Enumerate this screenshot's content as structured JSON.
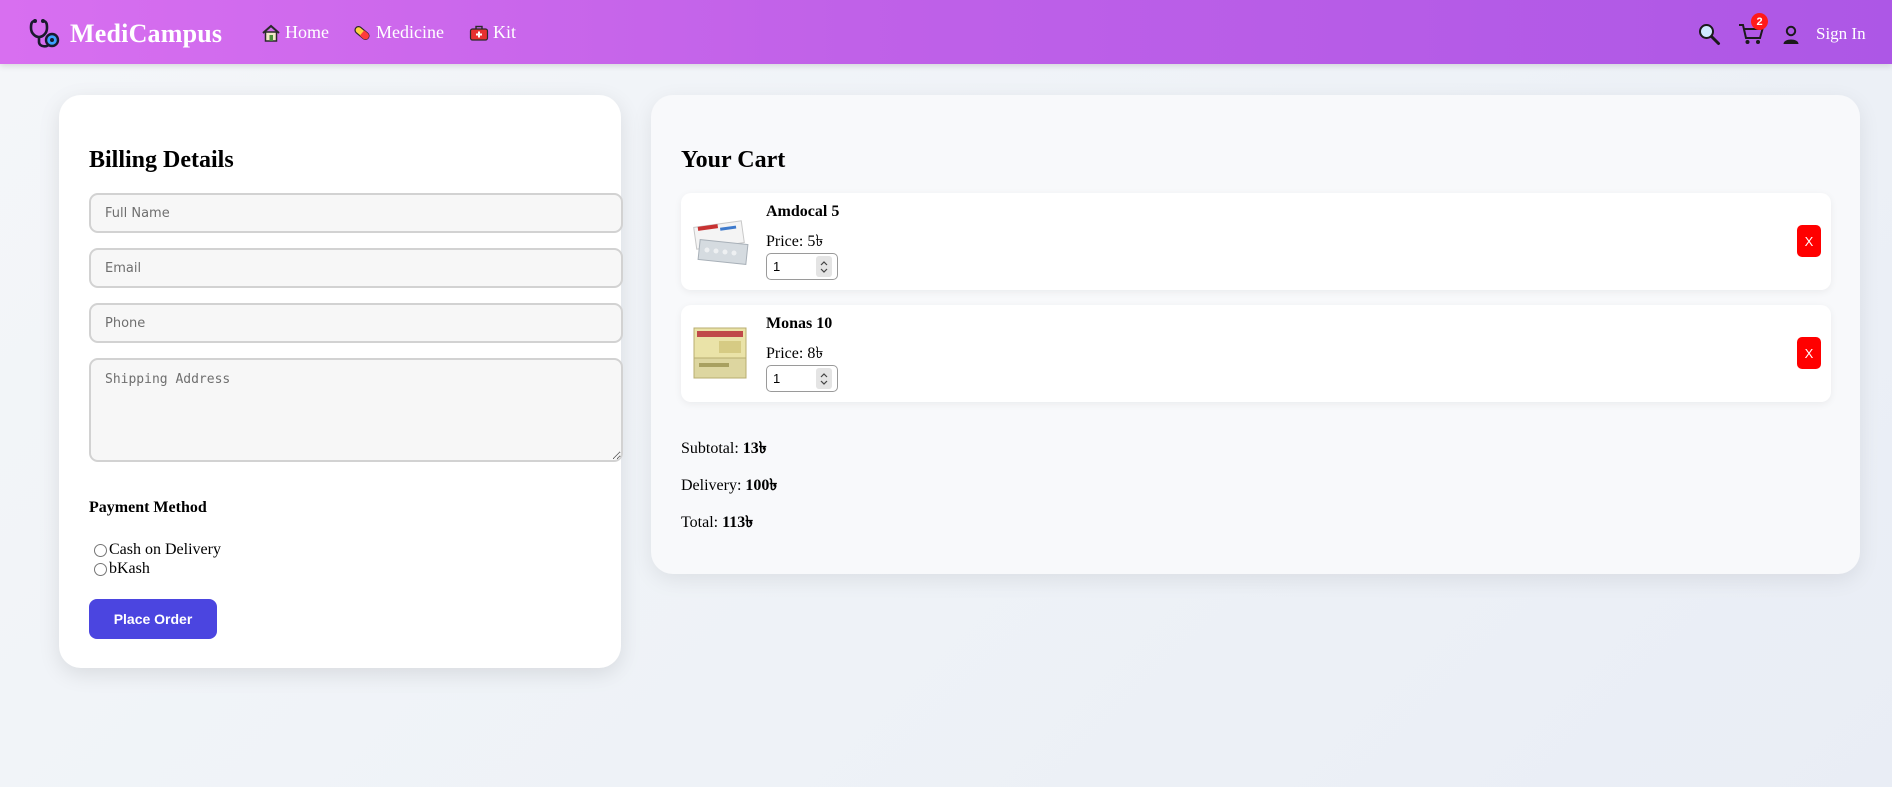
{
  "navbar": {
    "brand": "MediCampus",
    "links": [
      {
        "label": "Home",
        "icon": "home-icon"
      },
      {
        "label": "Medicine",
        "icon": "pill-icon"
      },
      {
        "label": "Kit",
        "icon": "medical-kit-icon"
      }
    ],
    "cart_count": "2",
    "sign_in": "Sign In"
  },
  "billing": {
    "title": "Billing Details",
    "full_name_placeholder": "Full Name",
    "email_placeholder": "Email",
    "phone_placeholder": "Phone",
    "address_placeholder": "Shipping Address",
    "payment_label": "Payment Method",
    "payment_options": [
      "Cash on Delivery",
      "bKash"
    ],
    "place_order": "Place Order"
  },
  "cart": {
    "title": "Your Cart",
    "items": [
      {
        "name": "Amdocal 5",
        "price_label": "Price:",
        "price": "5৳",
        "qty": "1",
        "remove": "X"
      },
      {
        "name": "Monas 10",
        "price_label": "Price:",
        "price": "8৳",
        "qty": "1",
        "remove": "X"
      }
    ],
    "subtotal_label": "Subtotal:",
    "subtotal": "13৳",
    "delivery_label": "Delivery:",
    "delivery": "100৳",
    "total_label": "Total:",
    "total": "113৳"
  },
  "colors": {
    "nav_gradient_start": "#d86ff0",
    "nav_gradient_end": "#ad57e6",
    "primary_button": "#4b45e0",
    "remove_button": "#ff0000",
    "badge": "#ff1a1a"
  }
}
